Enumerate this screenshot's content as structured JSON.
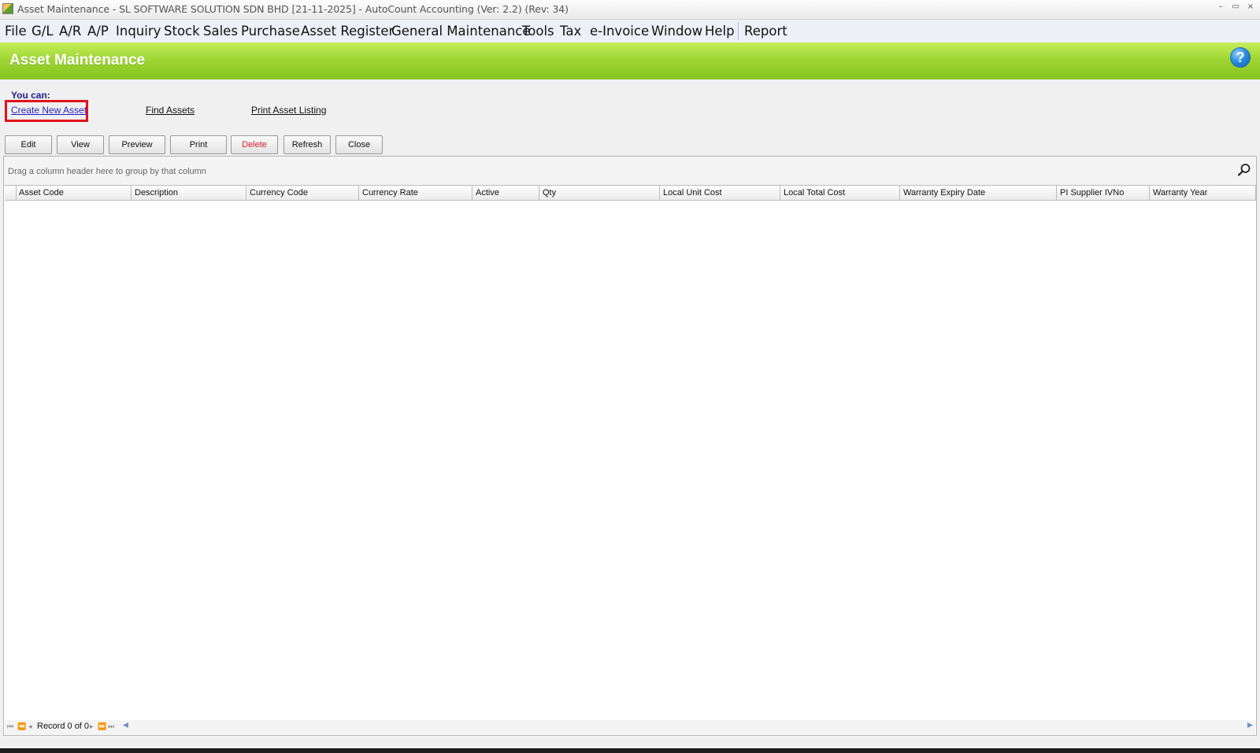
{
  "window": {
    "title": "Asset Maintenance - SL SOFTWARE SOLUTION SDN BHD [21-11-2025] - AutoCount Accounting (Ver: 2.2) (Rev: 34)",
    "controls": {
      "minimize": "–",
      "restore": "▭",
      "close": "×"
    }
  },
  "menu": {
    "items": [
      "File",
      "G/L",
      "A/R",
      "A/P",
      "Inquiry",
      "Stock",
      "Sales",
      "Purchase",
      "Asset Register",
      "General Maintenance",
      "Tools",
      "Tax",
      "e-Invoice",
      "Window",
      "Help",
      "Report"
    ]
  },
  "banner": {
    "title": "Asset Maintenance",
    "help_icon": "?"
  },
  "tasks": {
    "heading": "You can:",
    "links": [
      "Create New Asset",
      "Find Assets",
      "Print Asset Listing"
    ]
  },
  "toolbar": {
    "buttons": [
      "Edit",
      "View",
      "Preview",
      "Print",
      "Delete",
      "Refresh",
      "Close"
    ],
    "danger_color": "#d6202a"
  },
  "grid": {
    "group_hint": "Drag a column header here to group by that column",
    "columns": [
      "Asset Code",
      "Description",
      "Currency Code",
      "Currency Rate",
      "Active",
      "Qty",
      "Local Unit Cost",
      "Local Total Cost",
      "Warranty Expiry Date",
      "PI Supplier IVNo",
      "Warranty Year"
    ],
    "rows": []
  },
  "navigator": {
    "record_text": "Record 0 of 0"
  },
  "colors": {
    "banner_green": "#9fd634",
    "highlight_red": "#e0141b",
    "link_blue": "#1f1fbf"
  }
}
